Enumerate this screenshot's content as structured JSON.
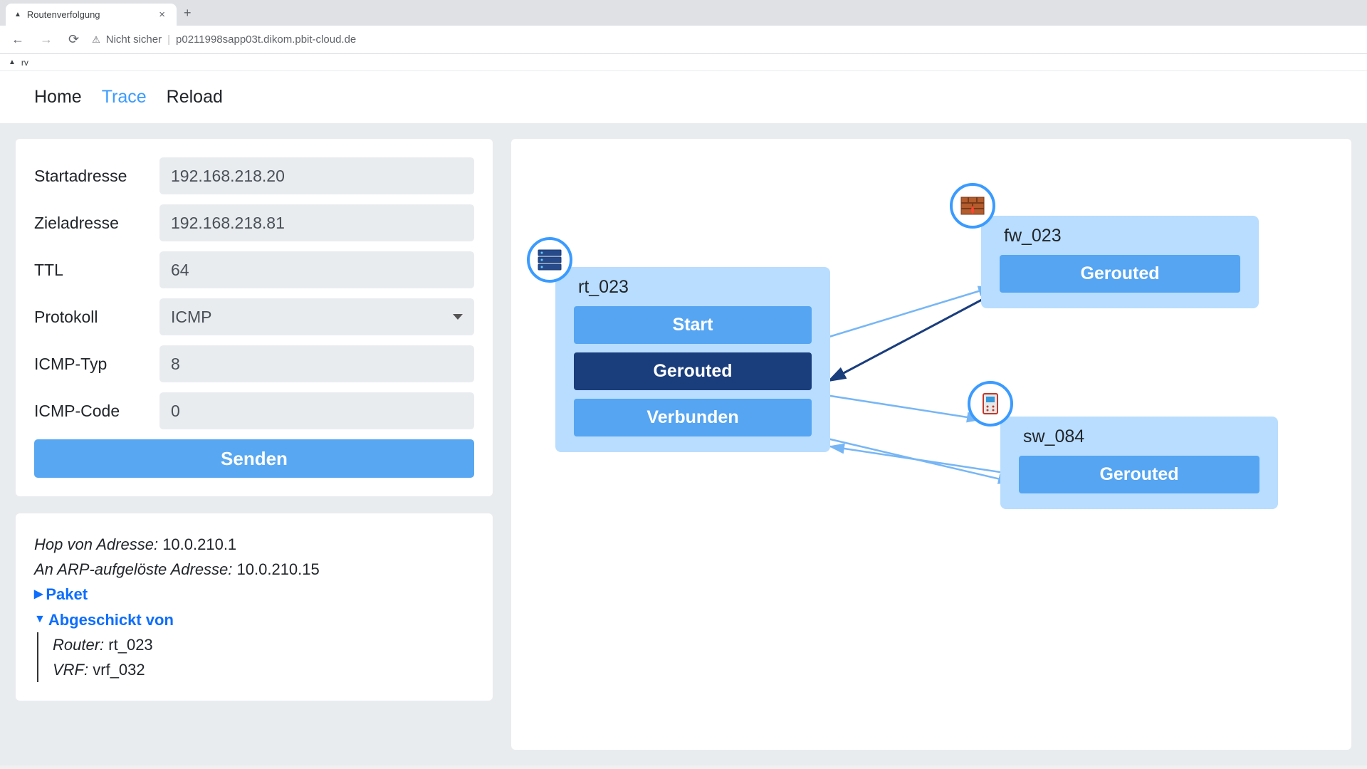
{
  "browser": {
    "tab_title": "Routenverfolgung",
    "security_label": "Nicht sicher",
    "url": "p0211998sapp03t.dikom.pbit-cloud.de",
    "bookmark_label": "rv"
  },
  "nav": {
    "home": "Home",
    "trace": "Trace",
    "reload": "Reload"
  },
  "form": {
    "start_label": "Startadresse",
    "start_value": "192.168.218.20",
    "target_label": "Zieladresse",
    "target_value": "192.168.218.81",
    "ttl_label": "TTL",
    "ttl_value": "64",
    "proto_label": "Protokoll",
    "proto_value": "ICMP",
    "icmp_type_label": "ICMP-Typ",
    "icmp_type_value": "8",
    "icmp_code_label": "ICMP-Code",
    "icmp_code_value": "0",
    "submit": "Senden"
  },
  "details": {
    "hop_label": "Hop von Adresse:",
    "hop_value": "10.0.210.1",
    "arp_label": "An ARP-aufgelöste Adresse:",
    "arp_value": "10.0.210.15",
    "paket_label": "Paket",
    "sentby_label": "Abgeschickt von",
    "router_label": "Router:",
    "router_value": "rt_023",
    "vrf_label": "VRF:",
    "vrf_value": "vrf_032"
  },
  "diagram": {
    "rt": {
      "name": "rt_023",
      "btn1": "Start",
      "btn2": "Gerouted",
      "btn3": "Verbunden"
    },
    "fw": {
      "name": "fw_023",
      "btn1": "Gerouted"
    },
    "sw": {
      "name": "sw_084",
      "btn1": "Gerouted"
    }
  }
}
